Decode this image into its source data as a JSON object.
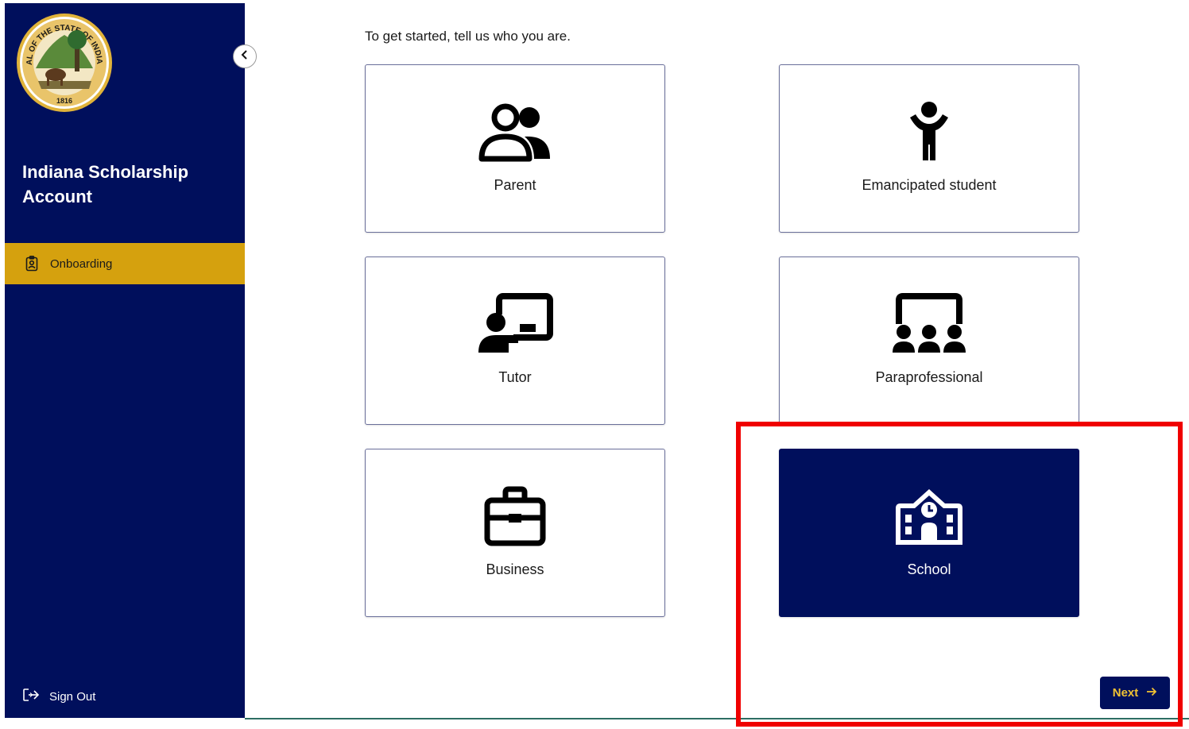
{
  "app": {
    "title": "Indiana Scholarship Account",
    "seal": {
      "text_top": "SEAL OF THE STATE OF INDIANA",
      "year": "1816"
    }
  },
  "sidebar": {
    "items": [
      {
        "label": "Onboarding",
        "icon": "id-badge-icon",
        "active": true
      }
    ],
    "signout_label": "Sign Out",
    "collapse_icon": "chevron-left-icon"
  },
  "main": {
    "prompt": "To get started, tell us who you are.",
    "roles": [
      {
        "label": "Parent",
        "icon": "people-icon",
        "selected": false
      },
      {
        "label": "Emancipated student",
        "icon": "child-icon",
        "selected": false
      },
      {
        "label": "Tutor",
        "icon": "presentation-icon",
        "selected": false
      },
      {
        "label": "Paraprofessional",
        "icon": "classroom-icon",
        "selected": false
      },
      {
        "label": "Business",
        "icon": "briefcase-icon",
        "selected": false
      },
      {
        "label": "School",
        "icon": "school-icon",
        "selected": true
      }
    ],
    "next_label": "Next"
  },
  "colors": {
    "sidebar_bg": "#000f5c",
    "active_nav": "#d5a10e",
    "selected_card": "#000f5c",
    "next_text": "#f1c233",
    "highlight": "#f00000"
  }
}
